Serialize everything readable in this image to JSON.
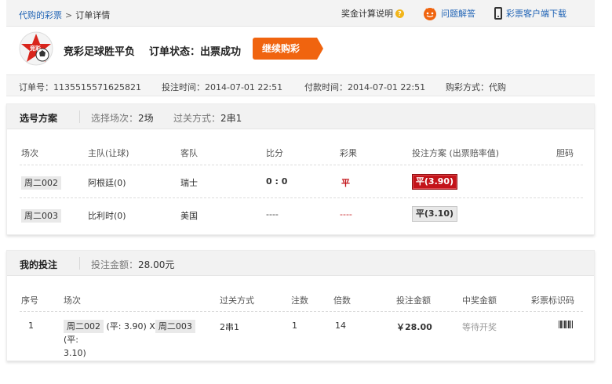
{
  "breadcrumb": {
    "root": "代购的彩票",
    "sep": ">",
    "current": "订单详情"
  },
  "topbar": {
    "prize_calc": "奖金计算说明",
    "faq": "问题解答",
    "client_download": "彩票客户端下载"
  },
  "header": {
    "lottery_name": "竞彩足球胜平负",
    "status_label": "订单状态：",
    "status_value": "出票成功",
    "continue_button": "继续购彩",
    "logo_text": "竞彩"
  },
  "order_info": {
    "order_no": "订单号：1135515571625821",
    "bet_time": "投注时间：2014-07-01 22:51",
    "pay_time": "付款时间：2014-07-01 22:51",
    "buy_method": "购彩方式：代购"
  },
  "selection": {
    "title": "选号方案",
    "matches_label": "选择场次：",
    "matches_value": "2场",
    "pass_label": "过关方式：",
    "pass_value": "2串1",
    "columns": [
      "场次",
      "主队(让球)",
      "客队",
      "比分",
      "彩果",
      "投注方案 (出票赔率值)",
      "胆码"
    ],
    "rows": [
      {
        "match": "周二002",
        "home": "阿根廷(0)",
        "away": "瑞士",
        "score": "0 : 0",
        "result": "平",
        "bet": "平(3.90)"
      },
      {
        "match": "周二003",
        "home": "比利时(0)",
        "away": "美国",
        "score": "----",
        "result": "----",
        "bet": "平(3.10)"
      }
    ]
  },
  "my_bet": {
    "title": "我的投注",
    "amount_label": "投注金额：",
    "amount_value": "28.00元",
    "columns": [
      "序号",
      "场次",
      "过关方式",
      "注数",
      "倍数",
      "投注金额",
      "中奖金额",
      "彩票标识码"
    ],
    "rows": [
      {
        "index": "1",
        "match1": "周二002",
        "odds1": "(平: 3.90)",
        "x": "X",
        "match2": "周二003",
        "odds2_a": "(平:",
        "odds2_b": "3.10)",
        "pass": "2串1",
        "notes": "1",
        "multiple": "14",
        "amount": "￥28.00",
        "prize": "等待开奖"
      }
    ]
  },
  "colors": {
    "accent_orange": "#f0640f",
    "link_blue": "#1f63b5",
    "selected_red": "#c3141a"
  }
}
